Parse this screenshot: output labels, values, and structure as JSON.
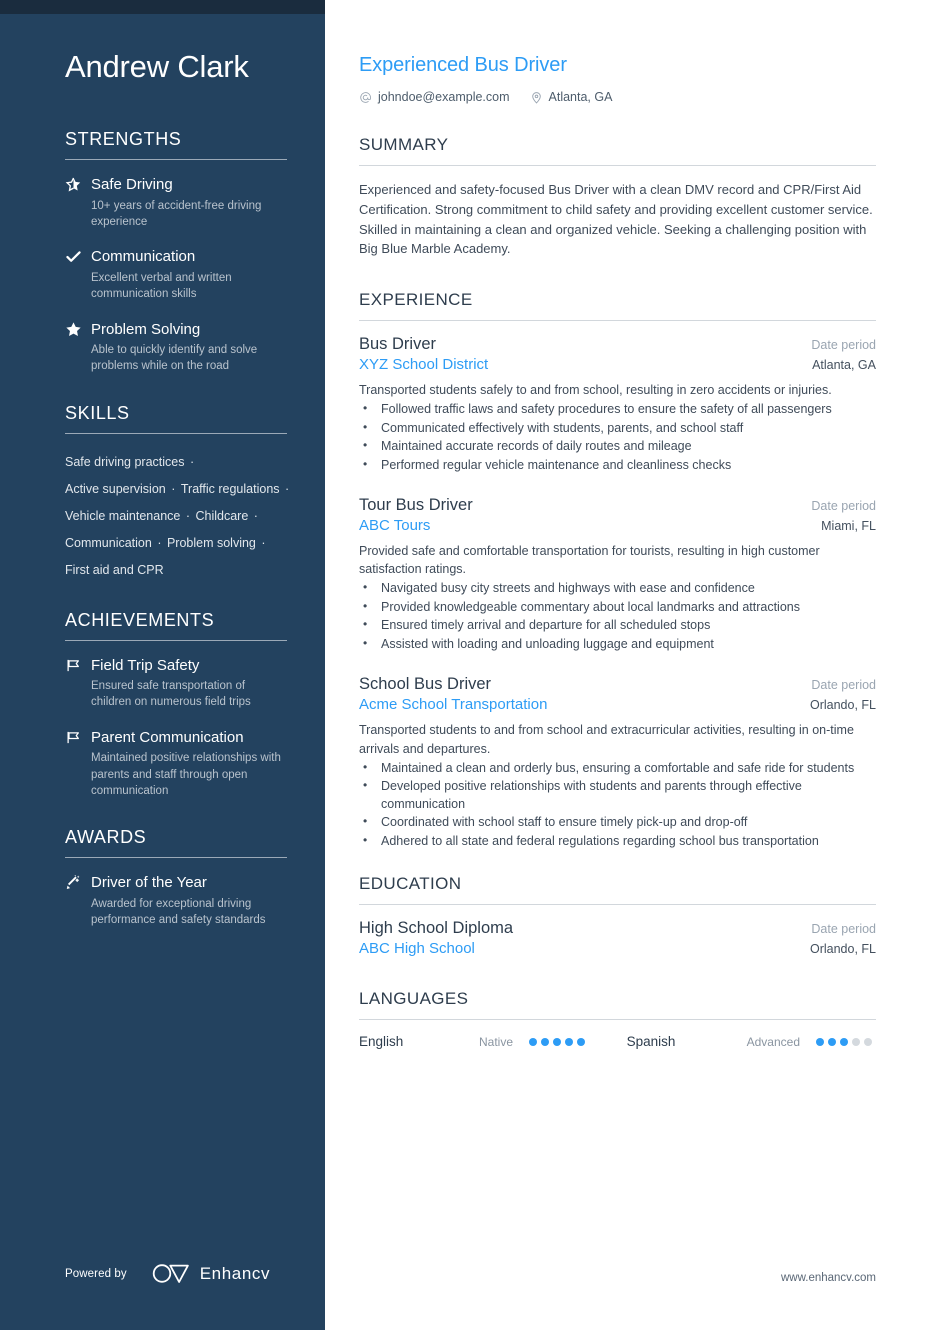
{
  "sidebar": {
    "name": "Andrew Clark",
    "strengths": {
      "heading": "STRENGTHS",
      "items": [
        {
          "icon": "half-star-icon",
          "title": "Safe Driving",
          "desc": "10+ years of accident-free driving experience"
        },
        {
          "icon": "check-icon",
          "title": "Communication",
          "desc": "Excellent verbal and written communication skills"
        },
        {
          "icon": "star-icon",
          "title": "Problem Solving",
          "desc": "Able to quickly identify and solve problems while on the road"
        }
      ]
    },
    "skills": {
      "heading": "SKILLS",
      "items": [
        "Safe driving practices",
        "Active supervision",
        "Traffic regulations",
        "Vehicle maintenance",
        "Childcare",
        "Communication",
        "Problem solving",
        "First aid and CPR"
      ],
      "separator": "·"
    },
    "achievements": {
      "heading": "ACHIEVEMENTS",
      "items": [
        {
          "icon": "flag-icon",
          "title": "Field Trip Safety",
          "desc": "Ensured safe transportation of children on numerous field trips"
        },
        {
          "icon": "flag-icon",
          "title": "Parent Communication",
          "desc": "Maintained positive relationships with parents and staff through open communication"
        }
      ]
    },
    "awards": {
      "heading": "AWARDS",
      "items": [
        {
          "icon": "magic-wand-icon",
          "title": "Driver of the Year",
          "desc": "Awarded for exceptional driving performance and safety standards"
        }
      ]
    },
    "brand": {
      "label": "Powered by",
      "name": "Enhancv"
    }
  },
  "main": {
    "job_title": "Experienced Bus Driver",
    "contact": {
      "email": "johndoe@example.com",
      "location": "Atlanta, GA"
    },
    "summary": {
      "heading": "SUMMARY",
      "text": "Experienced and safety-focused Bus Driver with a clean DMV record and CPR/First Aid Certification. Strong commitment to child safety and providing excellent customer service. Skilled in maintaining a clean and organized vehicle. Seeking a challenging position with Big Blue Marble Academy."
    },
    "experience": {
      "heading": "EXPERIENCE",
      "entries": [
        {
          "role": "Bus Driver",
          "date": "Date period",
          "org": "XYZ School District",
          "location": "Atlanta, GA",
          "desc": "Transported students safely to and from school, resulting in zero accidents or injuries.",
          "bullets": [
            "Followed traffic laws and safety procedures to ensure the safety of all passengers",
            "Communicated effectively with students, parents, and school staff",
            "Maintained accurate records of daily routes and mileage",
            "Performed regular vehicle maintenance and cleanliness checks"
          ]
        },
        {
          "role": "Tour Bus Driver",
          "date": "Date period",
          "org": "ABC Tours",
          "location": "Miami, FL",
          "desc": "Provided safe and comfortable transportation for tourists, resulting in high customer satisfaction ratings.",
          "bullets": [
            "Navigated busy city streets and highways with ease and confidence",
            "Provided knowledgeable commentary about local landmarks and attractions",
            "Ensured timely arrival and departure for all scheduled stops",
            "Assisted with loading and unloading luggage and equipment"
          ]
        },
        {
          "role": "School Bus Driver",
          "date": "Date period",
          "org": "Acme School Transportation",
          "location": "Orlando, FL",
          "desc": "Transported students to and from school and extracurricular activities, resulting in on-time arrivals and departures.",
          "bullets": [
            "Maintained a clean and orderly bus, ensuring a comfortable and safe ride for students",
            "Developed positive relationships with students and parents through effective communication",
            "Coordinated with school staff to ensure timely pick-up and drop-off",
            "Adhered to all state and federal regulations regarding school bus transportation"
          ]
        }
      ]
    },
    "education": {
      "heading": "EDUCATION",
      "entries": [
        {
          "degree": "High School Diploma",
          "date": "Date period",
          "school": "ABC High School",
          "location": "Orlando, FL"
        }
      ]
    },
    "languages": {
      "heading": "LANGUAGES",
      "items": [
        {
          "name": "English",
          "level": "Native",
          "filled": 5,
          "total": 5
        },
        {
          "name": "Spanish",
          "level": "Advanced",
          "filled": 3,
          "total": 5
        }
      ]
    },
    "site_url": "www.enhancv.com"
  },
  "colors": {
    "sidebar_bg": "#23425f",
    "sidebar_topbar": "#1a2c3e",
    "accent_blue": "#2d9cf5",
    "heading_dark": "#2e3d4d",
    "body_text": "#3f4b59",
    "muted": "#9aa5b1",
    "dot_off": "#d4d9de"
  }
}
